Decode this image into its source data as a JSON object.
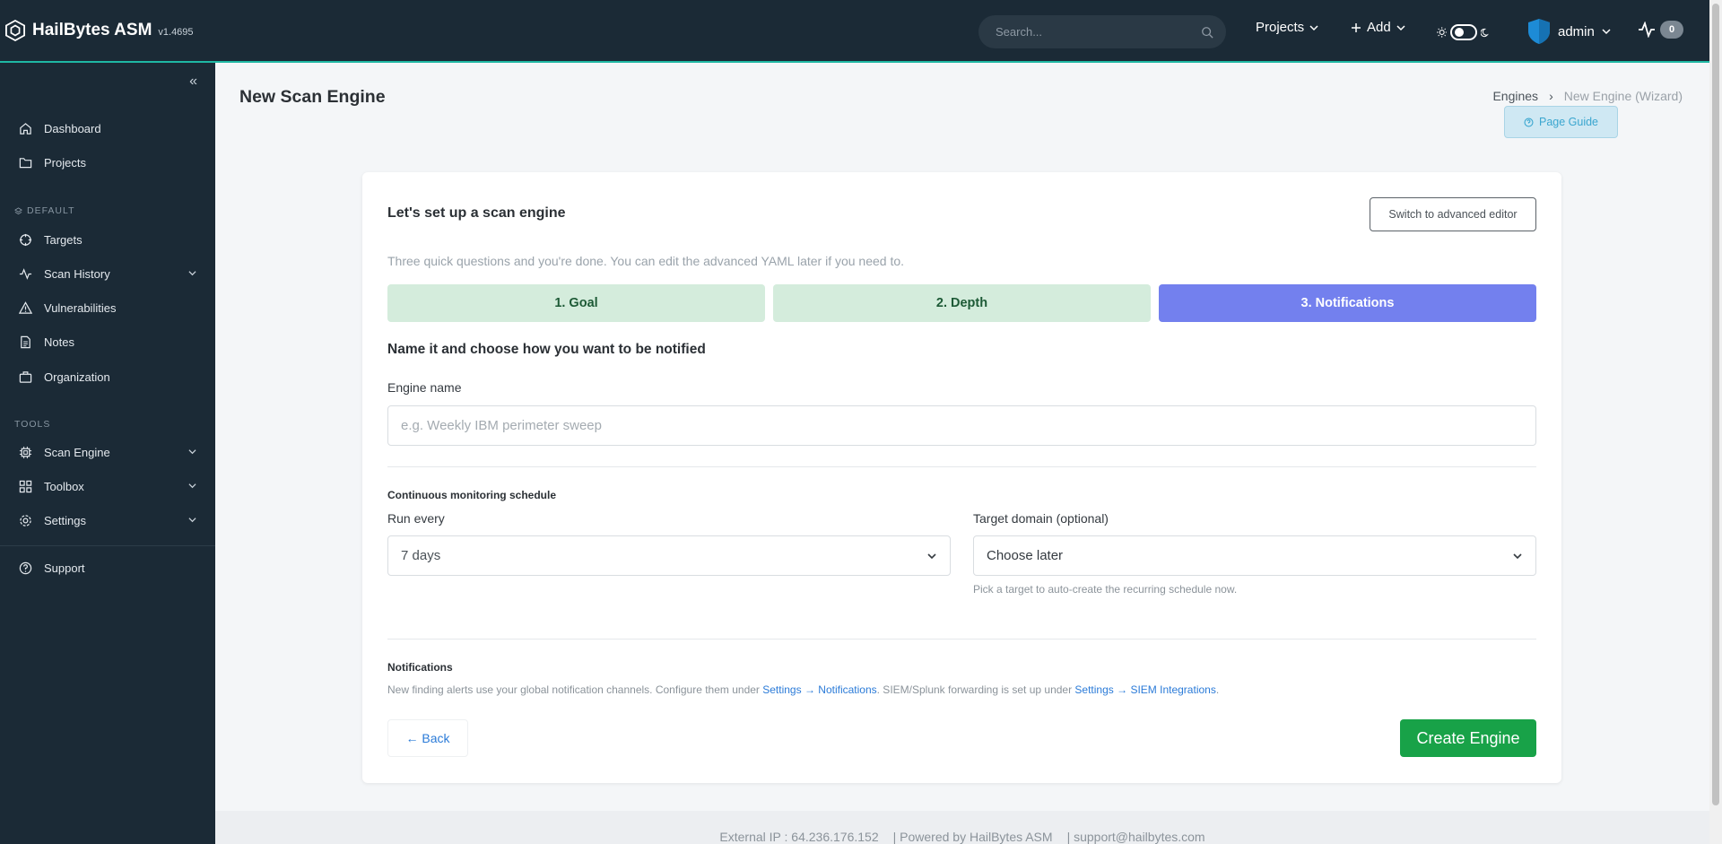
{
  "app": {
    "name": "HailBytes ASM",
    "version": "v1.4695"
  },
  "topbar": {
    "search_placeholder": "Search...",
    "projects_label": "Projects",
    "add_label": "Add",
    "user_label": "admin",
    "activity_count": "0"
  },
  "sidebar": {
    "items_main": [
      {
        "label": "Dashboard",
        "icon": "home-icon"
      },
      {
        "label": "Projects",
        "icon": "folder-icon"
      }
    ],
    "section_default": "DEFAULT",
    "items_default": [
      {
        "label": "Targets",
        "icon": "crosshair-icon"
      },
      {
        "label": "Scan History",
        "icon": "activity-icon"
      },
      {
        "label": "Vulnerabilities",
        "icon": "alert-triangle-icon"
      },
      {
        "label": "Notes",
        "icon": "file-text-icon"
      },
      {
        "label": "Organization",
        "icon": "briefcase-icon"
      }
    ],
    "section_tools": "TOOLS",
    "items_tools": [
      {
        "label": "Scan Engine",
        "icon": "cpu-icon"
      },
      {
        "label": "Toolbox",
        "icon": "grid-icon"
      },
      {
        "label": "Settings",
        "icon": "gear-icon"
      }
    ],
    "support_label": "Support"
  },
  "page": {
    "title": "New Scan Engine",
    "breadcrumb": [
      "Engines",
      "New Engine (Wizard)"
    ],
    "guide_label": "Page Guide"
  },
  "wizard": {
    "title": "Let's set up a scan engine",
    "advanced_label": "Switch to advanced editor",
    "subtitle": "Three quick questions and you're done. You can edit the advanced YAML later if you need to.",
    "steps": [
      "1. Goal",
      "2. Depth",
      "3. Notifications"
    ],
    "section_title": "Name it and choose how you want to be notified",
    "engine_name_label": "Engine name",
    "engine_name_placeholder": "e.g. Weekly IBM perimeter sweep",
    "schedule_heading": "Continuous monitoring schedule",
    "run_every_label": "Run every",
    "run_every_value": "7 days",
    "target_label": "Target domain (optional)",
    "target_value": "Choose later",
    "target_hint": "Pick a target to auto-create the recurring schedule now.",
    "notifications_heading": "Notifications",
    "notif_text_1": "New finding alerts use your global notification channels. Configure them under ",
    "notif_link_1": "Settings → Notifications",
    "notif_text_2": ". SIEM/Splunk forwarding is set up under ",
    "notif_link_2": "Settings → SIEM Integrations",
    "notif_text_3": ".",
    "back_label": "← Back",
    "create_label": "Create Engine"
  },
  "footer": {
    "ip": "External IP : 64.236.176.152",
    "powered": "| Powered by HailBytes ASM",
    "support": "| support@hailbytes.com"
  },
  "colors": {
    "accent": "#7380ee",
    "teal": "#1fb8a4",
    "success": "#18a248",
    "sidebar": "#1b2a36"
  }
}
